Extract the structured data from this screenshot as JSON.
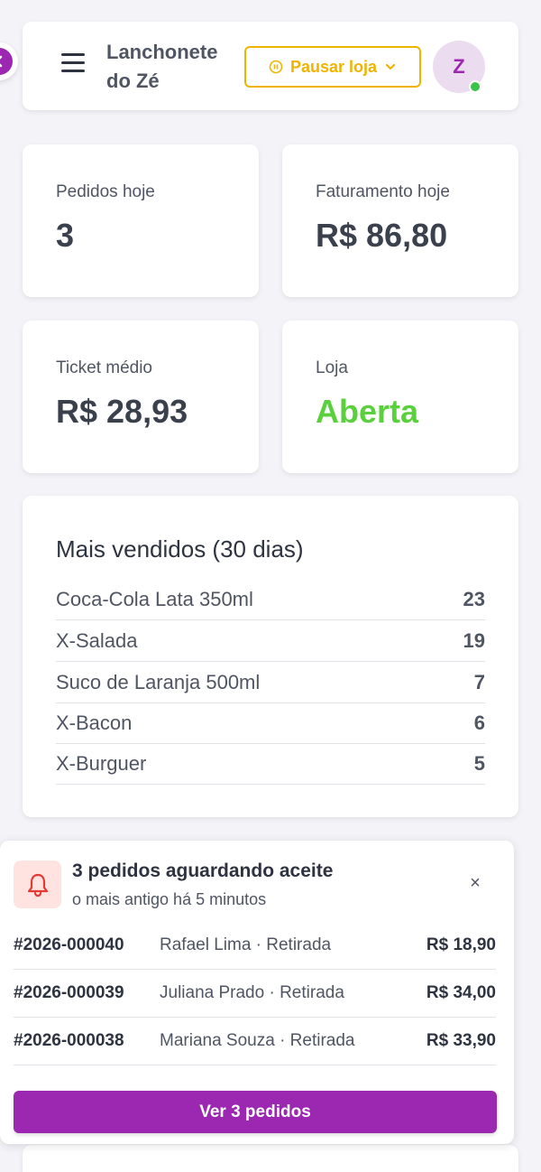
{
  "header": {
    "store_name": "Lanchonete do Zé",
    "pause_label": "Pausar loja",
    "avatar_initial": "Z"
  },
  "stats": [
    {
      "label": "Pedidos hoje",
      "value": "3"
    },
    {
      "label": "Faturamento hoje",
      "value": "R$ 86,80"
    },
    {
      "label": "Ticket médio",
      "value": "R$ 28,93"
    },
    {
      "label": "Loja",
      "value": "Aberta"
    }
  ],
  "top_sellers": {
    "title": "Mais vendidos (30 dias)",
    "items": [
      {
        "name": "Coca-Cola Lata 350ml",
        "qty": "23"
      },
      {
        "name": "X-Salada",
        "qty": "19"
      },
      {
        "name": "Suco de Laranja 500ml",
        "qty": "7"
      },
      {
        "name": "X-Bacon",
        "qty": "6"
      },
      {
        "name": "X-Burguer",
        "qty": "5"
      }
    ]
  },
  "notification": {
    "title": "3 pedidos aguardando aceite",
    "subtitle": "o mais antigo há 5 minutos",
    "close": "×",
    "orders": [
      {
        "id": "#2026-000040",
        "desc": "Rafael Lima · Retirada",
        "total": "R$ 18,90"
      },
      {
        "id": "#2026-000039",
        "desc": "Juliana Prado · Retirada",
        "total": "R$ 34,00"
      },
      {
        "id": "#2026-000038",
        "desc": "Mariana Souza · Retirada",
        "total": "R$ 33,90"
      }
    ],
    "cta_label": "Ver 3 pedidos"
  },
  "colors": {
    "accent": "#9c27b0",
    "pause": "#f0b400",
    "open_status": "#5ad13c"
  }
}
